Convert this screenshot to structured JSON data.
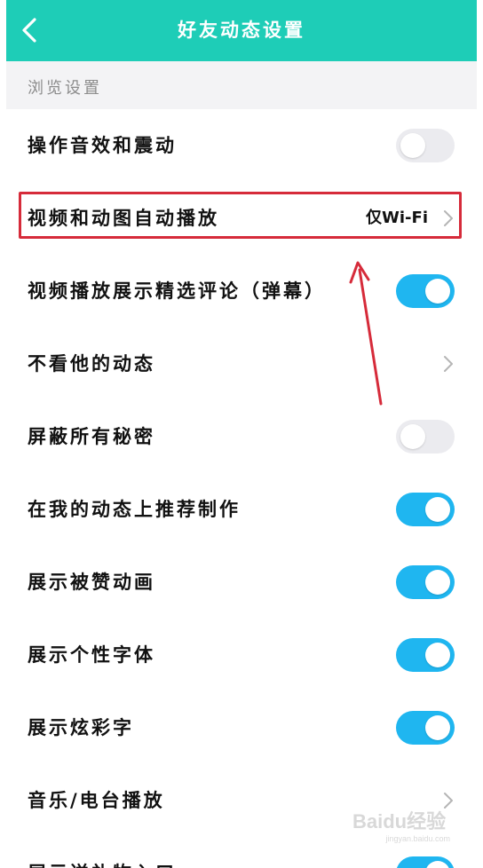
{
  "header": {
    "title": "好友动态设置",
    "back_icon": "chevron-left-icon"
  },
  "section": {
    "label": "浏览设置"
  },
  "rows": [
    {
      "label": "操作音效和震动",
      "control": "toggle",
      "state": "off"
    },
    {
      "label": "视频和动图自动播放",
      "control": "value",
      "value": "仅Wi-Fi"
    },
    {
      "label": "视频播放展示精选评论（弹幕）",
      "control": "toggle",
      "state": "on"
    },
    {
      "label": "不看他的动态",
      "control": "chevron"
    },
    {
      "label": "屏蔽所有秘密",
      "control": "toggle",
      "state": "off"
    },
    {
      "label": "在我的动态上推荐制作",
      "control": "toggle",
      "state": "on"
    },
    {
      "label": "展示被赞动画",
      "control": "toggle",
      "state": "on"
    },
    {
      "label": "展示个性字体",
      "control": "toggle",
      "state": "on"
    },
    {
      "label": "展示炫彩字",
      "control": "toggle",
      "state": "on"
    },
    {
      "label": "音乐/电台播放",
      "control": "chevron"
    },
    {
      "label": "展示送礼物入口",
      "control": "toggle",
      "state": "on"
    }
  ],
  "colors": {
    "header_bg": "#1ecdb7",
    "toggle_on": "#1fb6f0",
    "toggle_off": "#ebebef",
    "highlight": "#d62b3a"
  },
  "watermark": {
    "text": "Baidu经验",
    "sub": "jingyan.baidu.com"
  }
}
